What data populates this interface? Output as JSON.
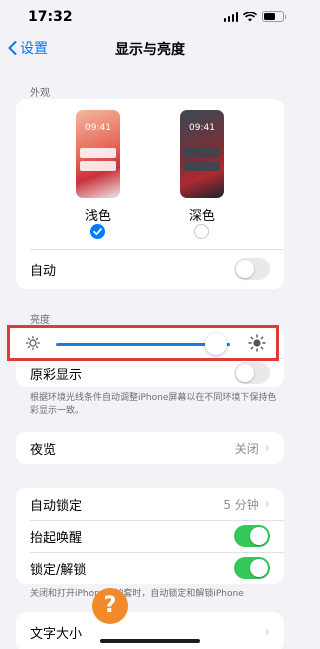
{
  "status_bar": {
    "time": "17:32"
  },
  "nav": {
    "back_label": "设置",
    "title": "显示与亮度"
  },
  "appearance": {
    "section_label": "外观",
    "light": {
      "preview_time": "09:41",
      "label": "浅色",
      "selected": true
    },
    "dark": {
      "preview_time": "09:41",
      "label": "深色",
      "selected": false
    },
    "auto_label": "自动",
    "auto_on": false
  },
  "brightness": {
    "section_label": "亮度",
    "level": 0.92,
    "true_tone_label": "原彩显示",
    "true_tone_on": false,
    "footnote": "根据环境光线条件自动调整iPhone屏幕以在不同环境下保持色彩显示一致。"
  },
  "night_shift": {
    "label": "夜览",
    "value": "关闭"
  },
  "lock": {
    "auto_lock_label": "自动锁定",
    "auto_lock_value": "5 分钟",
    "raise_to_wake_label": "抬起唤醒",
    "raise_to_wake_on": true,
    "lock_unlock_label": "锁定/解锁",
    "lock_unlock_on": true,
    "footnote": "关闭和打开iPhone保护套时，自动锁定和解锁iPhone"
  },
  "text_size": {
    "label": "文字大小"
  },
  "colors": {
    "accent": "#007aff",
    "switch_on": "#34c759",
    "highlight_border": "#e23a3a",
    "slider_fill": "#1c7ae0"
  }
}
